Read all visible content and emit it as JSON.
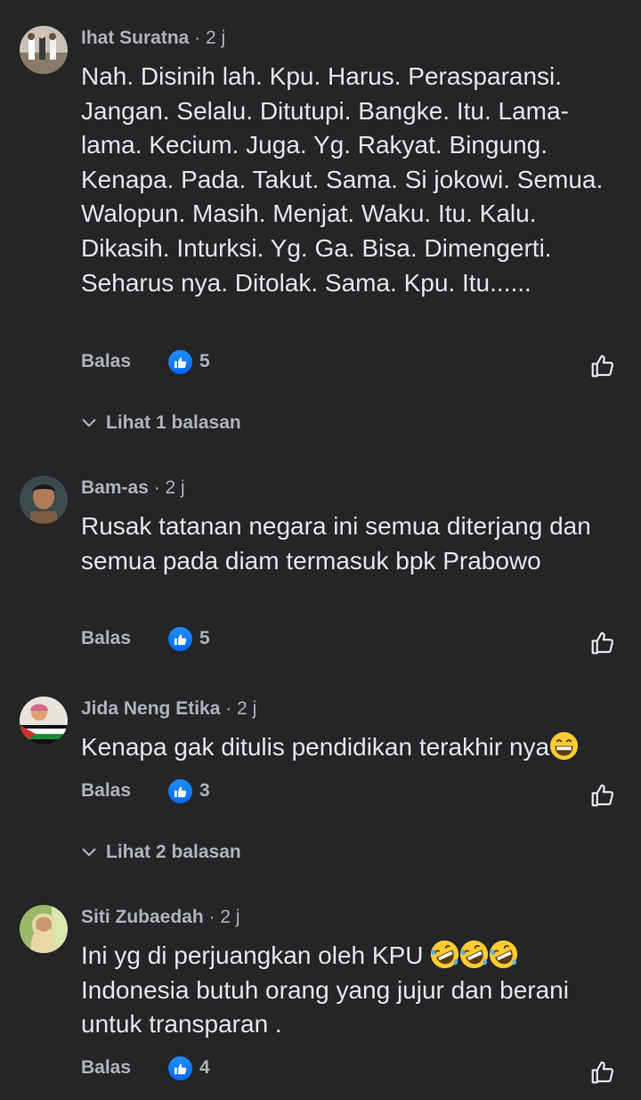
{
  "comments": [
    {
      "author": "Ihat Suratna",
      "time": "· 2 j",
      "text": "Nah. Disinih lah. Kpu. Harus. Perasparansi. Jangan. Selalu. Ditutupi. Bangke. Itu. Lama-lama. Kecium. Juga. Yg. Rakyat. Bingung. Kenapa. Pada. Takut. Sama. Si jokowi. Semua. Walopun. Masih. Menjat. Waku. Itu. Kalu. Dikasih. Inturksi. Yg. Ga. Bisa. Dimengerti. Seharus nya. Ditolak. Sama. Kpu. Itu......",
      "reply_label": "Balas",
      "reaction_count": "5",
      "view_replies": "Lihat 1 balasan"
    },
    {
      "author": "Bam-as",
      "time": "· 2 j",
      "text": "Rusak tatanan negara ini semua diterjang dan semua pada diam termasuk bpk Prabowo",
      "reply_label": "Balas",
      "reaction_count": "5"
    },
    {
      "author": "Jida Neng Etika",
      "time": "· 2 j",
      "text": "Kenapa gak ditulis pendidikan terakhir nya",
      "emoji": "grinning-face-with-smiling-eyes",
      "reply_label": "Balas",
      "reaction_count": "3",
      "view_replies": "Lihat 2 balasan"
    },
    {
      "author": "Siti Zubaedah",
      "time": "· 2 j",
      "text_line1": "Ini yg di perjuangkan oleh KPU",
      "emoji": "rolling-on-the-floor-laughing",
      "emoji_count": 3,
      "text_rest": "Indonesia butuh orang yang jujur dan berani untuk transparan .",
      "reply_label": "Balas",
      "reaction_count": "4"
    }
  ],
  "colors": {
    "background": "#242526",
    "primary_text": "#e4e6eb",
    "secondary_text": "#b0b3b8",
    "like_blue": "#0866ff"
  }
}
